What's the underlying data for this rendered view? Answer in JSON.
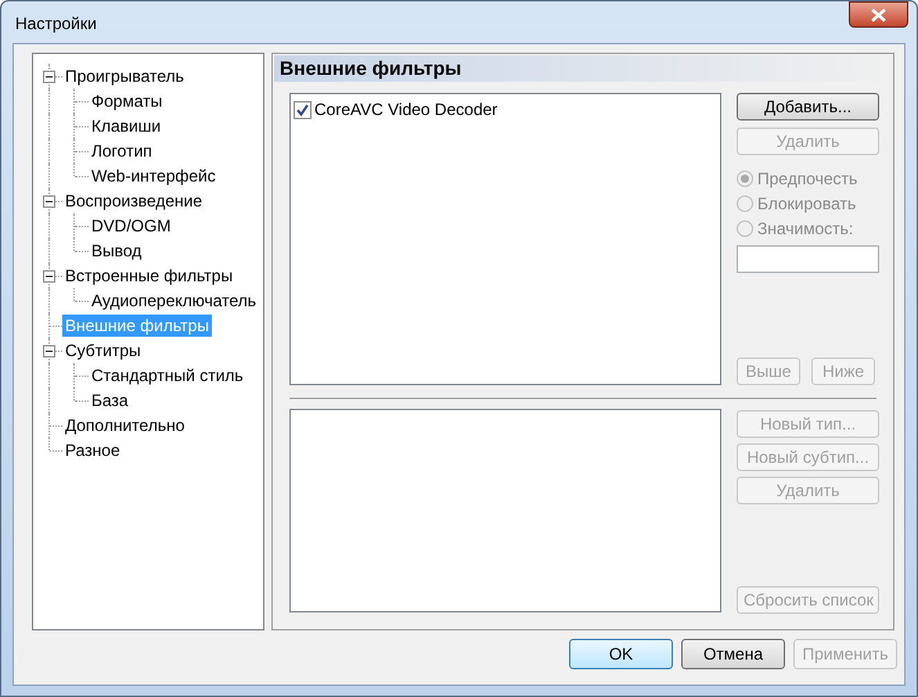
{
  "window": {
    "title": "Настройки"
  },
  "tree": [
    {
      "label": "Проигрыватель",
      "selected": false,
      "expanded": true,
      "children": [
        {
          "label": "Форматы",
          "selected": false
        },
        {
          "label": "Клавиши",
          "selected": false
        },
        {
          "label": "Логотип",
          "selected": false
        },
        {
          "label": "Web-интерфейс",
          "selected": false
        }
      ]
    },
    {
      "label": "Воспроизведение",
      "selected": false,
      "expanded": true,
      "children": [
        {
          "label": "DVD/OGM",
          "selected": false
        },
        {
          "label": "Вывод",
          "selected": false
        }
      ]
    },
    {
      "label": "Встроенные фильтры",
      "selected": false,
      "expanded": true,
      "children": [
        {
          "label": "Аудиопереключатель",
          "selected": false
        }
      ]
    },
    {
      "label": "Внешние фильтры",
      "selected": true
    },
    {
      "label": "Субтитры",
      "selected": false,
      "expanded": true,
      "children": [
        {
          "label": "Стандартный стиль",
          "selected": false
        },
        {
          "label": "База",
          "selected": false
        }
      ]
    },
    {
      "label": "Дополнительно",
      "selected": false
    },
    {
      "label": "Разное",
      "selected": false
    }
  ],
  "panel": {
    "title": "Внешние фильтры",
    "filters": [
      {
        "label": "CoreAVC Video Decoder",
        "checked": true
      }
    ],
    "filter_buttons": [
      {
        "label": "Добавить...",
        "disabled": false
      },
      {
        "label": "Удалить",
        "disabled": true
      }
    ],
    "options": [
      {
        "label": "Предпочесть",
        "selected": true,
        "disabled": true
      },
      {
        "label": "Блокировать",
        "selected": false,
        "disabled": true
      },
      {
        "label": "Значимость:",
        "selected": false,
        "disabled": true
      }
    ],
    "merit_field": {
      "disabled": true
    },
    "order_buttons": [
      {
        "label": "Выше",
        "disabled": true
      },
      {
        "label": "Ниже",
        "disabled": true
      }
    ],
    "type_buttons": [
      {
        "label": "Новый тип...",
        "disabled": true
      },
      {
        "label": "Новый субтип...",
        "disabled": true
      },
      {
        "label": "Удалить",
        "disabled": true
      }
    ],
    "reset_button": {
      "label": "Сбросить список",
      "disabled": true
    }
  },
  "dialog_buttons": [
    {
      "label": "OK",
      "default": true,
      "disabled": false
    },
    {
      "label": "Отмена",
      "default": false,
      "disabled": false
    },
    {
      "label": "Применить",
      "default": false,
      "disabled": true
    }
  ]
}
